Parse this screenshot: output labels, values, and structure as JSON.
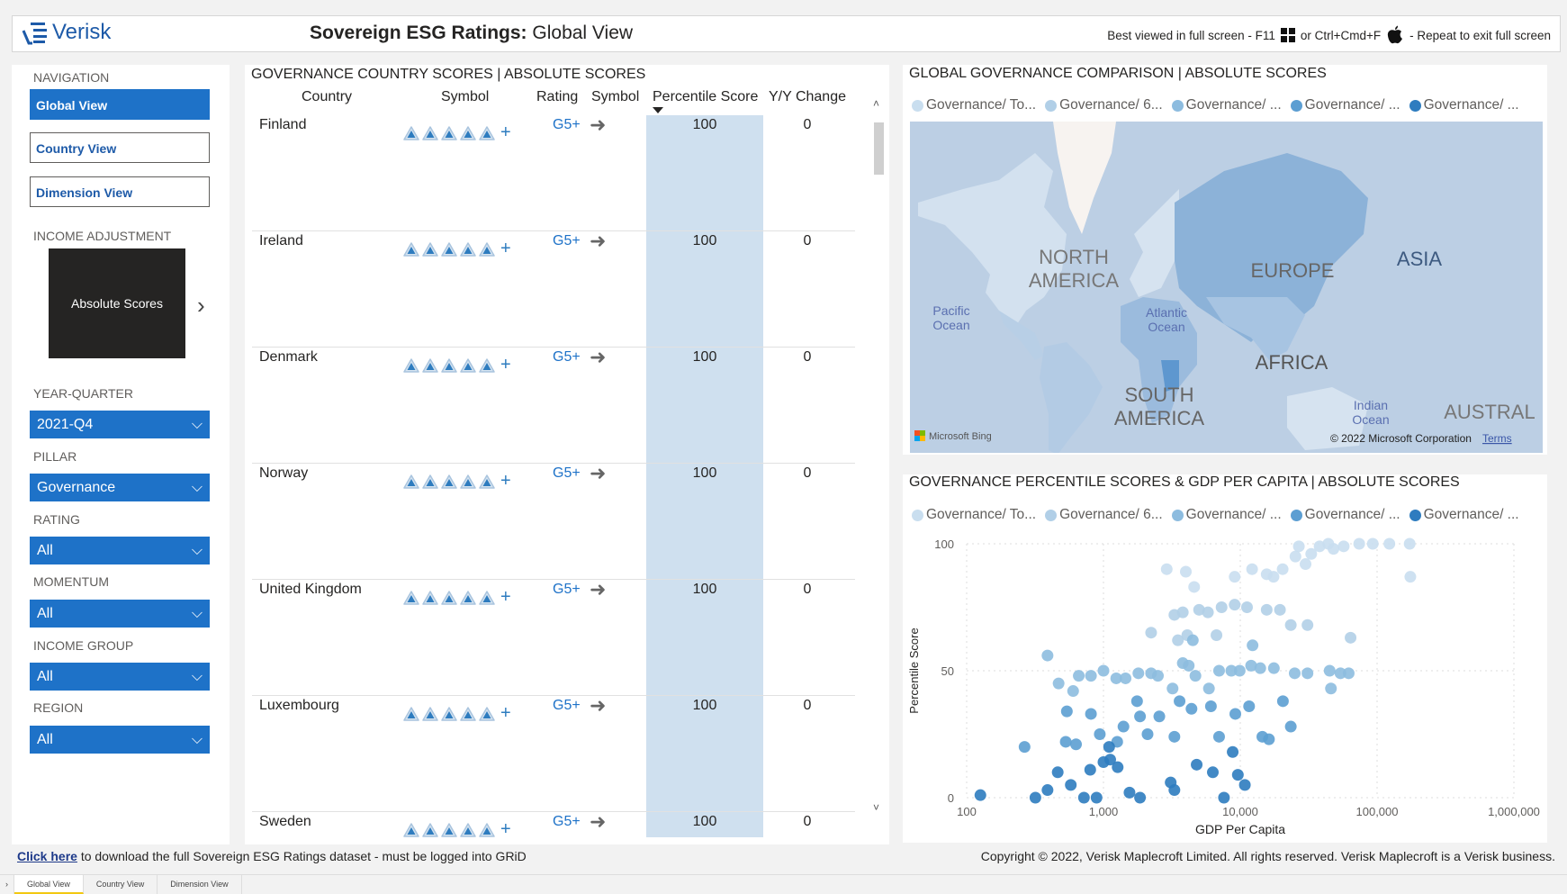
{
  "header": {
    "logo": "Verisk",
    "title_bold": "Sovereign ESG Ratings:",
    "title_rest": " Global View",
    "fullscreen_note": "Best viewed in full screen - F11",
    "or_text": "or Ctrl+Cmd+F",
    "exit_note": "- Repeat to exit full screen"
  },
  "sidebar": {
    "navigation_label": "NAVIGATION",
    "nav": [
      {
        "label": "Global View",
        "active": true
      },
      {
        "label": "Country View"
      },
      {
        "label": "Dimension View"
      }
    ],
    "income_adjustment_label": "INCOME ADJUSTMENT",
    "income_adjustment_value": "Absolute Scores",
    "filters": [
      {
        "label": "YEAR-QUARTER",
        "value": "2021-Q4"
      },
      {
        "label": "PILLAR",
        "value": "Governance"
      },
      {
        "label": "RATING",
        "value": "All"
      },
      {
        "label": "MOMENTUM",
        "value": "All"
      },
      {
        "label": "INCOME GROUP",
        "value": "All"
      },
      {
        "label": "REGION",
        "value": "All"
      }
    ]
  },
  "table": {
    "title": "GOVERNANCE COUNTRY SCORES | ABSOLUTE SCORES",
    "columns": [
      "Country",
      "Symbol",
      "Rating",
      "Symbol",
      "Percentile Score",
      "Y/Y Change"
    ],
    "sorted_column": "Percentile Score",
    "rows": [
      {
        "country": "Finland",
        "symbol_count": 5,
        "rating": "G5+",
        "momentum": "arrow-right",
        "percentile": "100",
        "yy": "0"
      },
      {
        "country": "Ireland",
        "symbol_count": 5,
        "rating": "G5+",
        "momentum": "arrow-right",
        "percentile": "100",
        "yy": "0"
      },
      {
        "country": "Denmark",
        "symbol_count": 5,
        "rating": "G5+",
        "momentum": "arrow-right",
        "percentile": "100",
        "yy": "0"
      },
      {
        "country": "Norway",
        "symbol_count": 5,
        "rating": "G5+",
        "momentum": "arrow-right",
        "percentile": "100",
        "yy": "0"
      },
      {
        "country": "United Kingdom",
        "symbol_count": 5,
        "rating": "G5+",
        "momentum": "arrow-right",
        "percentile": "100",
        "yy": "0"
      },
      {
        "country": "Luxembourg",
        "symbol_count": 5,
        "rating": "G5+",
        "momentum": "arrow-right",
        "percentile": "100",
        "yy": "0"
      },
      {
        "country": "Sweden",
        "symbol_count": 5,
        "rating": "G5+",
        "momentum": "arrow-right",
        "percentile": "100",
        "yy": "0"
      }
    ]
  },
  "legend": [
    "Governance/ To...",
    "Governance/ 6...",
    "Governance/ ...",
    "Governance/ ...",
    "Governance/ ..."
  ],
  "series_colors": [
    "#c9deef",
    "#b1cfe7",
    "#8dbcdf",
    "#5c9ed2",
    "#2e7cbf"
  ],
  "map": {
    "title": "GLOBAL GOVERNANCE COMPARISON | ABSOLUTE SCORES",
    "labels": {
      "north_america": "NORTH AMERICA",
      "south_america": "SOUTH AMERICA",
      "europe": "EUROPE",
      "asia": "ASIA",
      "africa": "AFRICA",
      "australia": "AUSTRAL",
      "pacific": "Pacific Ocean",
      "atlantic": "Atlantic Ocean",
      "indian": "Indian Ocean"
    },
    "provider": "Microsoft Bing",
    "copyright": "© 2022 Microsoft Corporation",
    "terms": "Terms"
  },
  "scatter": {
    "title": "GOVERNANCE PERCENTILE SCORES & GDP PER CAPITA | ABSOLUTE SCORES"
  },
  "chart_data": {
    "type": "scatter",
    "xlabel": "GDP Per Capita",
    "ylabel": "Percentile Score",
    "x_scale": "log",
    "xlim": [
      100,
      1000000
    ],
    "ylim": [
      0,
      100
    ],
    "x_ticks": [
      "100",
      "1,000",
      "10,000",
      "100,000",
      "1,000,000"
    ],
    "y_ticks": [
      "0",
      "50",
      "100"
    ],
    "grid": true,
    "legend_position": "top",
    "series": [
      {
        "name": "Governance/ To...",
        "points": [
          [
            2900,
            90
          ],
          [
            4000,
            89
          ],
          [
            4600,
            83
          ],
          [
            9100,
            87
          ],
          [
            12200,
            90
          ],
          [
            17500,
            87
          ],
          [
            15600,
            88
          ],
          [
            20400,
            90
          ],
          [
            25300,
            95
          ],
          [
            26800,
            99
          ],
          [
            30000,
            92
          ],
          [
            33000,
            96
          ],
          [
            38000,
            99
          ],
          [
            44000,
            100
          ],
          [
            48000,
            98
          ],
          [
            57000,
            99
          ],
          [
            74000,
            100
          ],
          [
            93000,
            100
          ],
          [
            123000,
            100
          ],
          [
            173000,
            100
          ],
          [
            175000,
            87
          ]
        ]
      },
      {
        "name": "Governance/ 6...",
        "points": [
          [
            2230,
            65
          ],
          [
            3300,
            72
          ],
          [
            3500,
            62
          ],
          [
            3800,
            73
          ],
          [
            4100,
            64
          ],
          [
            5000,
            74
          ],
          [
            5800,
            73
          ],
          [
            6700,
            64
          ],
          [
            7300,
            75
          ],
          [
            9100,
            76
          ],
          [
            11200,
            75
          ],
          [
            15600,
            74
          ],
          [
            19500,
            74
          ],
          [
            23400,
            68
          ],
          [
            31000,
            68
          ],
          [
            64000,
            63
          ]
        ]
      },
      {
        "name": "Governance/ ...",
        "points": [
          [
            390,
            56
          ],
          [
            470,
            45
          ],
          [
            600,
            42
          ],
          [
            660,
            48
          ],
          [
            810,
            48
          ],
          [
            1000,
            50
          ],
          [
            1240,
            47
          ],
          [
            1450,
            47
          ],
          [
            1800,
            49
          ],
          [
            2230,
            49
          ],
          [
            2500,
            48
          ],
          [
            3200,
            43
          ],
          [
            3800,
            53
          ],
          [
            4200,
            52
          ],
          [
            4500,
            62
          ],
          [
            4700,
            48
          ],
          [
            5900,
            43
          ],
          [
            7000,
            50
          ],
          [
            8600,
            50
          ],
          [
            9900,
            50
          ],
          [
            12000,
            52
          ],
          [
            12300,
            60
          ],
          [
            14000,
            51
          ],
          [
            17600,
            51
          ],
          [
            25000,
            49
          ],
          [
            31000,
            49
          ],
          [
            45000,
            50
          ],
          [
            46000,
            43
          ],
          [
            54000,
            49
          ],
          [
            62000,
            49
          ]
        ]
      },
      {
        "name": "Governance/ ...",
        "points": [
          [
            265,
            20
          ],
          [
            530,
            22
          ],
          [
            540,
            34
          ],
          [
            630,
            21
          ],
          [
            810,
            33
          ],
          [
            940,
            25
          ],
          [
            1260,
            22
          ],
          [
            1400,
            28
          ],
          [
            1760,
            38
          ],
          [
            1850,
            32
          ],
          [
            2100,
            25
          ],
          [
            2560,
            32
          ],
          [
            3300,
            24
          ],
          [
            3600,
            38
          ],
          [
            4400,
            35
          ],
          [
            6100,
            36
          ],
          [
            7000,
            24
          ],
          [
            9200,
            33
          ],
          [
            11600,
            36
          ],
          [
            14500,
            24
          ],
          [
            16200,
            23
          ],
          [
            20500,
            38
          ],
          [
            23400,
            28
          ]
        ]
      },
      {
        "name": "Governance/ ...",
        "points": [
          [
            126,
            1
          ],
          [
            318,
            0
          ],
          [
            390,
            3
          ],
          [
            463,
            10
          ],
          [
            577,
            5
          ],
          [
            720,
            0
          ],
          [
            800,
            11
          ],
          [
            890,
            0
          ],
          [
            1000,
            14
          ],
          [
            1100,
            20
          ],
          [
            1120,
            15
          ],
          [
            1270,
            12
          ],
          [
            1550,
            2
          ],
          [
            1850,
            0
          ],
          [
            3100,
            6
          ],
          [
            3300,
            3
          ],
          [
            4800,
            13
          ],
          [
            6300,
            10
          ],
          [
            7600,
            0
          ],
          [
            8800,
            18
          ],
          [
            9600,
            9
          ],
          [
            10800,
            5
          ]
        ]
      }
    ]
  },
  "footer": {
    "link": "Click here",
    "link_rest": " to download the full Sovereign ESG Ratings dataset - must be logged into GRiD",
    "copyright": "Copyright © 2022, Verisk Maplecroft Limited. All rights reserved. Verisk Maplecroft is a Verisk business."
  },
  "tabs": [
    {
      "label": "Global View",
      "active": true
    },
    {
      "label": "Country View"
    },
    {
      "label": "Dimension View"
    }
  ]
}
